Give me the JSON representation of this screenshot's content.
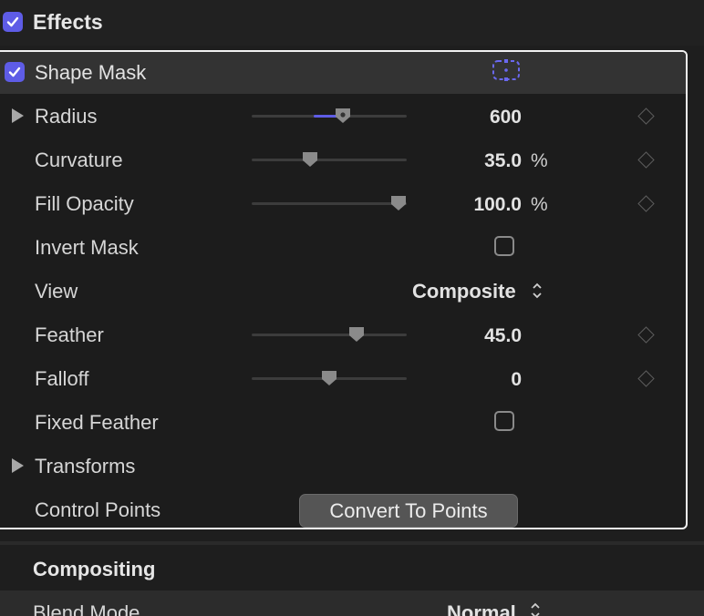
{
  "effects": {
    "label": "Effects",
    "enabled": true
  },
  "shape_mask": {
    "label": "Shape Mask",
    "enabled": true,
    "icon": "shape-mask-onscreen-controls-icon",
    "accent_color": "#5e5ce6"
  },
  "params": {
    "radius": {
      "label": "Radius",
      "value": "600",
      "slider_fraction": 0.6,
      "fill_start_fraction": 0.4
    },
    "curvature": {
      "label": "Curvature",
      "value": "35.0",
      "unit": "%",
      "slider_fraction": 0.36
    },
    "fill_opacity": {
      "label": "Fill Opacity",
      "value": "100.0",
      "unit": "%",
      "slider_fraction": 1.0
    },
    "invert_mask": {
      "label": "Invert Mask",
      "checked": false
    },
    "view": {
      "label": "View",
      "value": "Composite"
    },
    "feather": {
      "label": "Feather",
      "value": "45.0",
      "slider_fraction": 0.7
    },
    "falloff": {
      "label": "Falloff",
      "value": "0",
      "slider_fraction": 0.5
    },
    "fixed_feather": {
      "label": "Fixed Feather",
      "checked": false
    },
    "transforms": {
      "label": "Transforms"
    },
    "control_points": {
      "label": "Control Points",
      "button_label": "Convert To Points"
    }
  },
  "compositing": {
    "label": "Compositing",
    "blend_mode": {
      "label": "Blend Mode",
      "value": "Normal"
    }
  }
}
